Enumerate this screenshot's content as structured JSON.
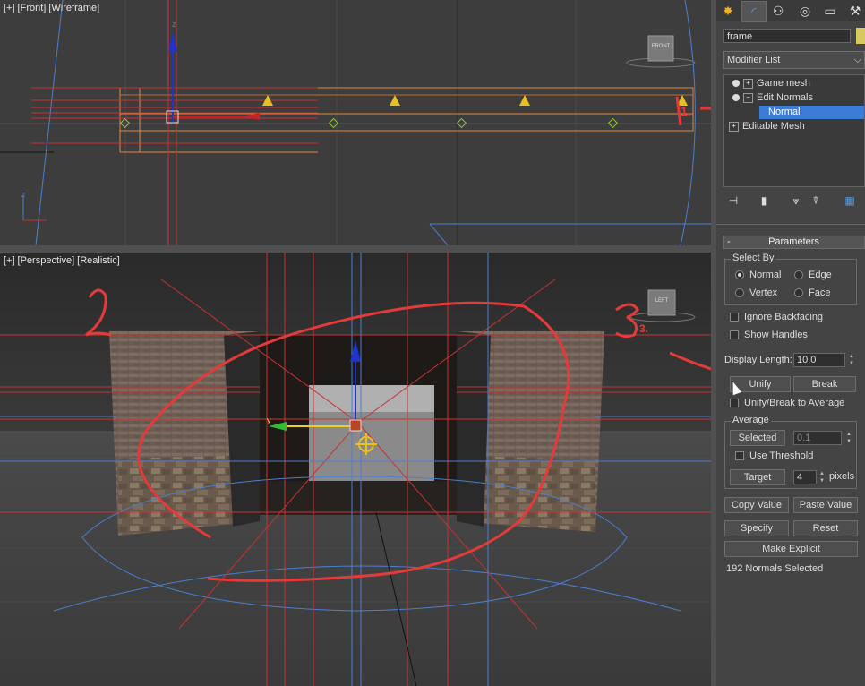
{
  "viewports": {
    "front": {
      "plus": "[+]",
      "view": "[Front]",
      "shading": "[Wireframe]",
      "viewcube": "FRONT"
    },
    "perspective": {
      "plus": "[+]",
      "view": "[Perspective]",
      "shading": "[Realistic]",
      "viewcube": "LEFT"
    }
  },
  "annotations": {
    "one": "1.",
    "two": "2",
    "three": "3."
  },
  "panel": {
    "tabs": [
      "create-icon",
      "modify-icon",
      "hierarchy-icon",
      "motion-icon",
      "display-icon",
      "utilities-icon"
    ],
    "object_name": "frame",
    "object_color": "#d8c860",
    "modifier_list": "Modifier List",
    "stack": [
      {
        "label": "Game mesh",
        "indent": 0
      },
      {
        "label": "Edit Normals",
        "indent": 0
      },
      {
        "label": "Normal",
        "indent": 1,
        "selected": true
      },
      {
        "label": "Editable Mesh",
        "indent": 0
      }
    ],
    "parameters_title": "Parameters",
    "select_by": {
      "title": "Select By",
      "options": [
        "Normal",
        "Edge",
        "Vertex",
        "Face"
      ],
      "selected": "Normal"
    },
    "ignore_backfacing": "Ignore Backfacing",
    "show_handles": "Show Handles",
    "display_length_label": "Display Length:",
    "display_length_value": "10.0",
    "unify": "Unify",
    "break": "Break",
    "unify_break_avg": "Unify/Break to Average",
    "average": {
      "title": "Average",
      "selected_btn": "Selected",
      "selected_value": "0.1",
      "use_threshold": "Use Threshold",
      "target_btn": "Target",
      "target_value": "4",
      "pixels": "pixels"
    },
    "copy_value": "Copy Value",
    "paste_value": "Paste Value",
    "specify": "Specify",
    "reset": "Reset",
    "make_explicit": "Make Explicit",
    "status": "192 Normals Selected"
  }
}
